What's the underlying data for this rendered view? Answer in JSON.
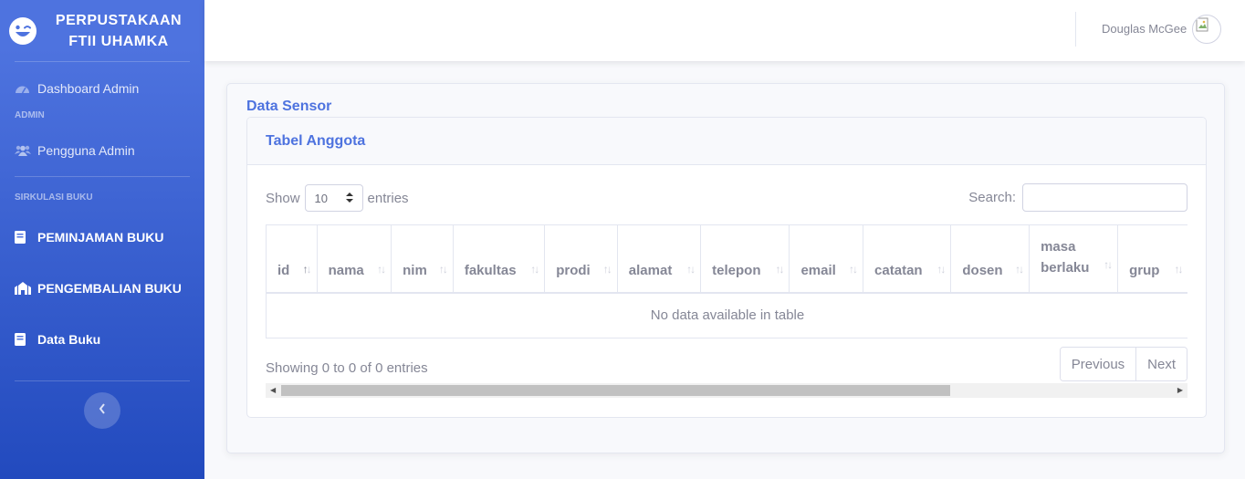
{
  "sidebar": {
    "brand_line1": "PERPUSTAKAAN",
    "brand_line2": "FTII UHAMKA",
    "dashboard": "Dashboard Admin",
    "heading_admin": "ADMIN",
    "pengguna": "Pengguna Admin",
    "heading_sirkulasi": "SIRKULASI BUKU",
    "peminjaman": "PEMINJAMAN BUKU",
    "pengembalian": "PENGEMBALIAN BUKU",
    "data_buku": "Data Buku",
    "toggle_icon": "chevron-left-icon"
  },
  "topbar": {
    "user_name": "Douglas McGee",
    "avatar_icon": "broken-image-icon"
  },
  "main": {
    "section_title": "Data Sensor",
    "card_title": "Tabel Anggota",
    "show_label": "Show",
    "entries_value": "10",
    "entries_label": "entries",
    "search_label": "Search:",
    "search_value": "",
    "columns": [
      "id",
      "nama",
      "nim",
      "fakultas",
      "prodi",
      "alamat",
      "telepon",
      "email",
      "catatan",
      "dosen",
      "masa berlaku",
      "grup"
    ],
    "empty_message": "No data available in table",
    "info_text": "Showing 0 to 0 of 0 entries",
    "prev_label": "Previous",
    "next_label": "Next"
  },
  "colors": {
    "primary": "#4e73df",
    "sidebar_gradient_end": "#224abe",
    "text_muted": "#858796"
  }
}
